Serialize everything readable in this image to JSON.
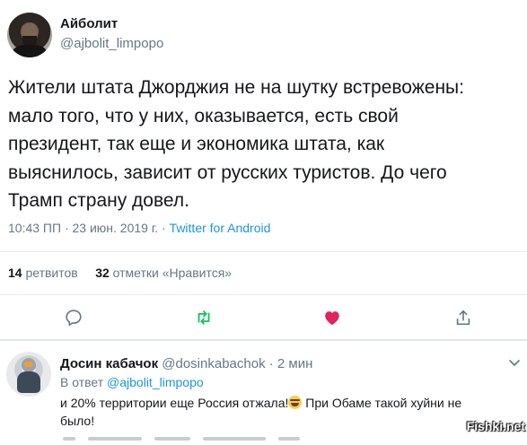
{
  "tweet": {
    "author_name": "Айболит",
    "author_handle": "@ajbolit_limpopo",
    "text": "Жители штата Джорджия не на шутку встревожены:\nмало того, что у них, оказывается, есть свой\nпрезидент, так еще и экономика штата, как\nвыяснилось, зависит от русских туристов. До чего\nТрамп страну довел.",
    "timestamp": "10:43 ПП · 23 июн. 2019 г. · ",
    "source": "Twitter for Android",
    "retweets_count": "14",
    "retweets_label": "ретвитов",
    "likes_count": "32",
    "likes_label": "отметки «Нравится»"
  },
  "actions": {
    "reply_icon": "reply-icon",
    "retweet_icon": "retweet-icon",
    "like_icon": "heart-icon",
    "share_icon": "share-icon"
  },
  "reply": {
    "author_name": "Досин кабачок",
    "author_handle": "@dosinkabachok",
    "time": "· 2 мин",
    "in_reply_prefix": "В ответ ",
    "in_reply_handle": "@ajbolit_limpopo",
    "text_part1": "и 20% территории еще Россия отжала!",
    "text_part2": " При Обаме такой хуйни не было!"
  },
  "watermark": "Fishki.net",
  "colors": {
    "link": "#1b95e0",
    "retweet_green": "#17bf63",
    "like_red": "#e0245e",
    "muted": "#657786"
  }
}
